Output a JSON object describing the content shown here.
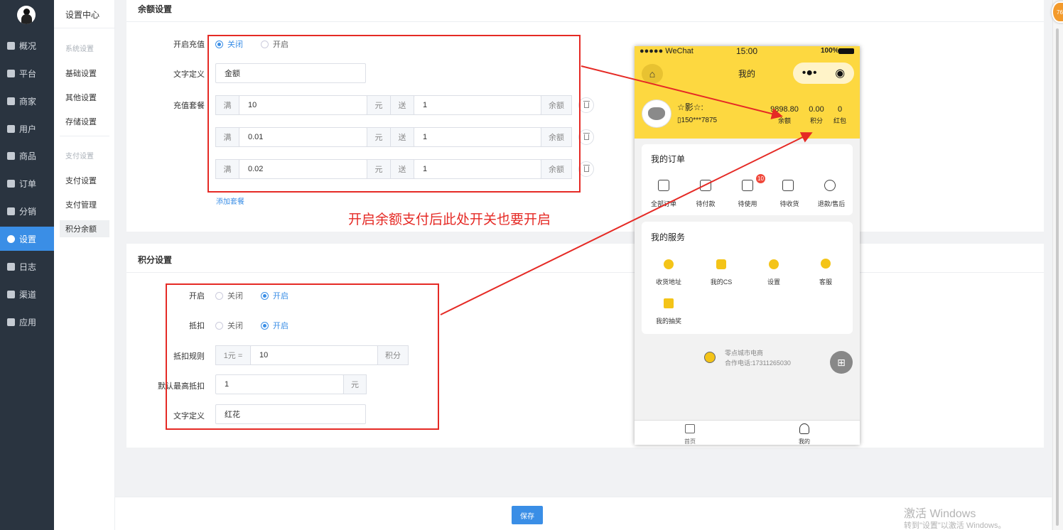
{
  "nav": [
    "概况",
    "平台",
    "商家",
    "用户",
    "商品",
    "订单",
    "分销",
    "设置",
    "日志",
    "渠道",
    "应用"
  ],
  "nav_active_index": 7,
  "sub": {
    "title": "设置中心",
    "group1": "系统设置",
    "items1": [
      "基础设置",
      "其他设置",
      "存储设置"
    ],
    "group2": "支付设置",
    "items2": [
      "支付设置",
      "支付管理",
      "积分余额"
    ],
    "active": "积分余额"
  },
  "balance": {
    "section_title": "余额设置",
    "enable_label": "开启充值",
    "off": "关闭",
    "on": "开启",
    "enabled": false,
    "name_label": "文字定义",
    "name_value": "金额",
    "packages_label": "充值套餐",
    "full": "满",
    "yuan": "元",
    "give": "送",
    "unit": "余额",
    "packages": [
      {
        "amount": "10",
        "gift": "1"
      },
      {
        "amount": "0.01",
        "gift": "1"
      },
      {
        "amount": "0.02",
        "gift": "1"
      }
    ],
    "add_package": "添加套餐"
  },
  "annotation": {
    "text": "开启余额支付后此处开关也要开启",
    "color": "#e52a25"
  },
  "points": {
    "section_title": "积分设置",
    "enable_label": "开启",
    "deduct_label": "抵扣",
    "off": "关闭",
    "on": "开启",
    "enabled": true,
    "deduct_enabled": true,
    "rule_label": "抵扣规则",
    "rule_prefix": "1元 =",
    "rule_value": "10",
    "rule_unit": "积分",
    "max_label": "默认最高抵扣",
    "max_value": "1",
    "max_unit": "元",
    "name_label": "文字定义",
    "name_value": "红花"
  },
  "save": "保存",
  "phone": {
    "status_left": "●●●●● WeChat",
    "status_time": "15:00",
    "status_battery": "100%",
    "title": "我的",
    "user_name": "☆影☆:",
    "user_phone": "150***7875",
    "stats": [
      {
        "value": "9898.80",
        "label": "余额"
      },
      {
        "value": "0.00",
        "label": "积分"
      },
      {
        "value": "0",
        "label": "红包"
      }
    ],
    "orders_title": "我的订单",
    "orders": [
      "全部订单",
      "待付款",
      "待使用",
      "待收货",
      "退款/售后"
    ],
    "orders_badge": "10",
    "services_title": "我的服务",
    "services": [
      "收货地址",
      "我的CS",
      "设置",
      "客服",
      "我的抽奖"
    ],
    "shop_name": "零点城市电商",
    "shop_phone": "合作电话:17311265030",
    "tabs": [
      "首页",
      "我的"
    ]
  },
  "corner_badge": "76",
  "watermark": {
    "line1": "激活 Windows",
    "line2": "转到\"设置\"以激活 Windows。"
  },
  "colors": {
    "sidebar_bg": "#2a3440",
    "accent": "#3a8ee6",
    "annotation_red": "#e52a25",
    "phone_yellow": "#fdd840"
  }
}
